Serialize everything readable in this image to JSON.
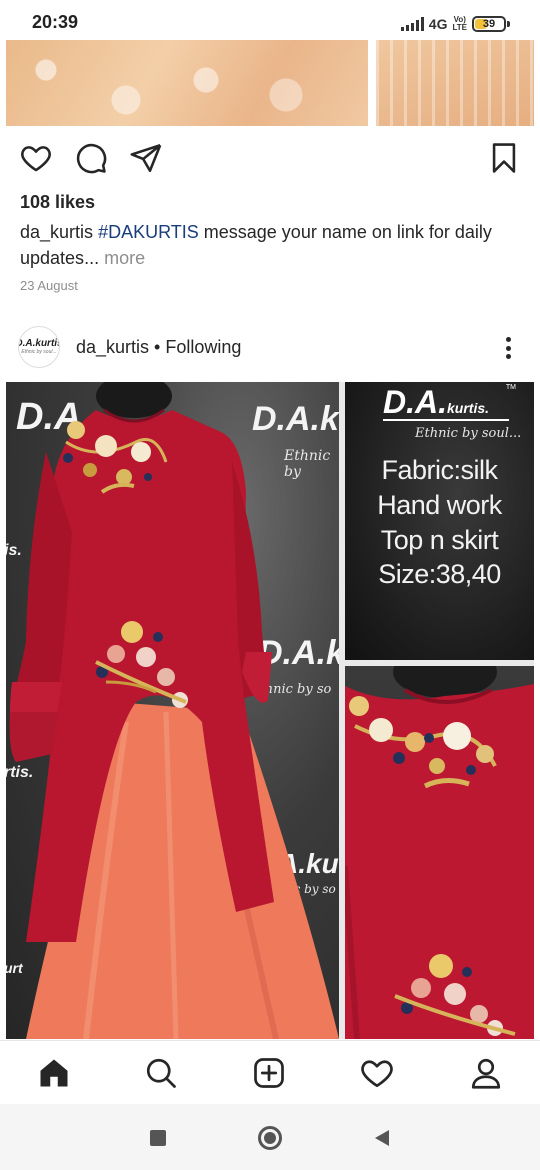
{
  "status_bar": {
    "time": "20:39",
    "network": "4G",
    "volte_top": "Vo)",
    "volte_bottom": "LTE",
    "battery": "39",
    "battery_percent": 39
  },
  "post_prev": {
    "likes": "108 likes",
    "caption_user": "da_kurtis",
    "caption_tag": "#DAKURTIS",
    "caption_text": " message your name on link for daily updates",
    "caption_ellipsis": "...",
    "more_label": " more",
    "date": "23 August"
  },
  "post": {
    "username": "da_kurtis",
    "separator": " • ",
    "follow_status": "Following",
    "avatar_logo": "D.A.kurtis",
    "avatar_tagline": "Ethnic by soul...",
    "image": {
      "brand_main": "D.A.",
      "brand_suffix": "kurtis.",
      "trademark": "TM",
      "tagline": "Ethnic by soul...",
      "lines": [
        "Fabric:silk",
        "Hand work",
        "Top n skirt",
        "Size:38,40"
      ],
      "wm_brand": "D.A.",
      "wm_brand_2": "D.A.k",
      "wm_brand_3": "A.kurt",
      "wm_tag": "Ethnic by",
      "wm_tag_2": "Ethnic by so",
      "wm_tag_3": "nic by so",
      "wm_cut_1": "is.",
      "wm_cut_2": "rtis.",
      "wm_cut_3": "urt"
    }
  },
  "icons": {
    "like": "heart-icon",
    "comment": "comment-icon",
    "share": "send-icon",
    "save": "bookmark-icon"
  },
  "tab_bar": [
    "home-icon",
    "search-icon",
    "add-post-icon",
    "activity-heart-icon",
    "profile-icon"
  ],
  "nav_bar": [
    "recents-square",
    "home-circle",
    "back-triangle"
  ],
  "colors": {
    "hashtag": "#1a3d7c",
    "muted": "#8e8e8e",
    "kurta_red": "#b8172f",
    "skirt_peach": "#f07a5a",
    "battery_fill": "#f2c23a"
  }
}
